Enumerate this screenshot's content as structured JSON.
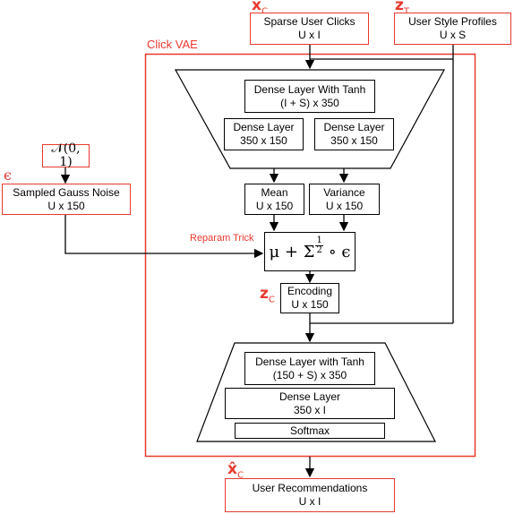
{
  "colors": {
    "accent": "#e8392f",
    "line": "#000000"
  },
  "container": {
    "label": "Click VAE"
  },
  "inputs": {
    "sparse_clicks": {
      "var": "x",
      "sub": "C",
      "title": "Sparse User Clicks",
      "dims": "U x I"
    },
    "style_profiles": {
      "var": "z",
      "sub": "T",
      "title": "User Style Profiles",
      "dims": "U x S"
    }
  },
  "noise": {
    "prior": "𝒩(0, 1)",
    "var": "ϵ",
    "title": "Sampled Gauss Noise",
    "dims": "U x 150"
  },
  "encoder": {
    "dense_tanh": {
      "title": "Dense Layer With Tanh",
      "dims": "(I + S) x 350"
    },
    "dense_left": {
      "title": "Dense Layer",
      "dims": "350 x 150"
    },
    "dense_right": {
      "title": "Dense Layer",
      "dims": "350 x 150"
    }
  },
  "mean": {
    "title": "Mean",
    "dims": "U x 150"
  },
  "variance": {
    "title": "Variance",
    "dims": "U x 150"
  },
  "reparam": {
    "label": "Reparam Trick",
    "formula_mu": "μ + Σ",
    "formula_num": "1",
    "formula_den": "2",
    "formula_tail": "∘ ϵ"
  },
  "encoding": {
    "var": "z",
    "sub": "C",
    "title": "Encoding",
    "dims": "U x 150"
  },
  "decoder": {
    "dense_tanh": {
      "title": "Dense Layer with Tanh",
      "dims": "(150 + S) x 350"
    },
    "dense": {
      "title": "Dense Layer",
      "dims": "350 x I"
    },
    "softmax": {
      "title": "Softmax"
    }
  },
  "output": {
    "var": "x̂",
    "sub": "C",
    "title": "User Recommendations",
    "dims": "U x I"
  }
}
